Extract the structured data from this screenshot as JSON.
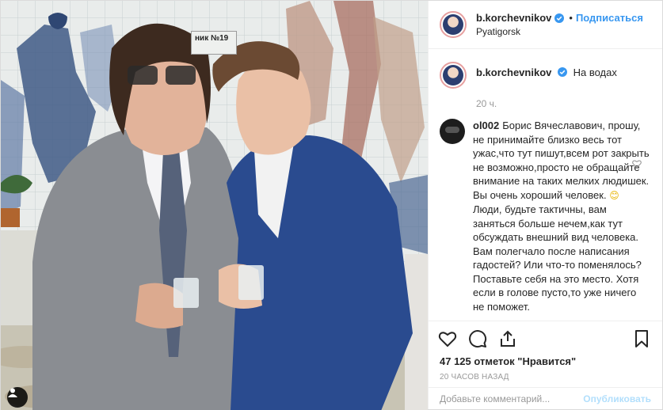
{
  "photo": {
    "sign_text": "ник №19",
    "tag_icon": "person-tag-icon"
  },
  "header": {
    "username": "b.korchevnikov",
    "verified_icon": "verified-badge-icon",
    "separator": "•",
    "follow_label": "Подписаться",
    "location": "Pyatigorsk"
  },
  "caption": {
    "username": "b.korchevnikov",
    "text": "На водах",
    "time": "20 ч."
  },
  "comment": {
    "username": "ol002",
    "text_before_emoji": "Борис Вячеславович, прошу, не принимайте близко весь тот ужас,что тут пишут,всем рот закрыть не возможно,просто не обращайте внимание на таких мелких людишек. Вы очень хороший человек. ",
    "emoji": "😊",
    "text_after_emoji": " Люди, будьте тактичны, вам заняться больше нечем,как тут обсуждать внешний вид человека. Вам полегчало после написания гадостей? Или что-то поменялось? Поставьте себя на это место. Хотя если в голове пусто,то уже ничего не поможет.",
    "like_icon": "heart-outline-icon"
  },
  "actions": {
    "like_icon": "heart-icon",
    "comment_icon": "comment-icon",
    "share_icon": "share-icon",
    "save_icon": "bookmark-icon"
  },
  "likes_text": "47 125 отметок \"Нравится\"",
  "posted_ago": "20 ЧАСОВ НАЗАД",
  "add_comment": {
    "placeholder": "Добавьте комментарий...",
    "publish_label": "Опубликовать"
  },
  "colors": {
    "accent": "#3897f0",
    "publish_disabled": "#b2dffc",
    "text": "#262626",
    "muted": "#999999",
    "border": "#efefef"
  }
}
